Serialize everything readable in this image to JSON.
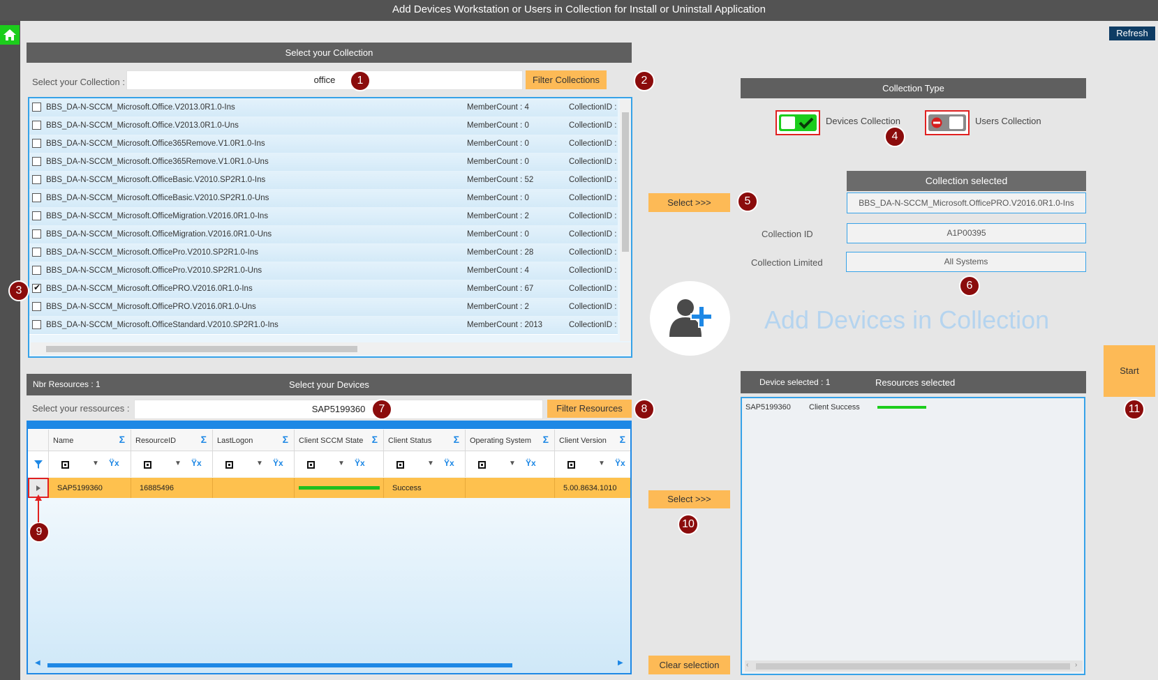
{
  "window": {
    "title": "Add Devices Workstation or Users in Collection for Install or Uninstall Application",
    "refresh_label": "Refresh"
  },
  "collection_panel": {
    "header": "Select your Collection",
    "search_label": "Select your Collection :",
    "search_value": "office",
    "filter_button": "Filter Collections",
    "items": [
      {
        "name": "BBS_DA-N-SCCM_Microsoft.Office.V2013.0R1.0-Ins",
        "member": "MemberCount : 4",
        "cid": "CollectionID :",
        "checked": false
      },
      {
        "name": "BBS_DA-N-SCCM_Microsoft.Office.V2013.0R1.0-Uns",
        "member": "MemberCount : 0",
        "cid": "CollectionID :",
        "checked": false
      },
      {
        "name": "BBS_DA-N-SCCM_Microsoft.Office365Remove.V1.0R1.0-Ins",
        "member": "MemberCount : 0",
        "cid": "CollectionID :",
        "checked": false
      },
      {
        "name": "BBS_DA-N-SCCM_Microsoft.Office365Remove.V1.0R1.0-Uns",
        "member": "MemberCount : 0",
        "cid": "CollectionID :",
        "checked": false
      },
      {
        "name": "BBS_DA-N-SCCM_Microsoft.OfficeBasic.V2010.SP2R1.0-Ins",
        "member": "MemberCount : 52",
        "cid": "CollectionID :",
        "checked": false
      },
      {
        "name": "BBS_DA-N-SCCM_Microsoft.OfficeBasic.V2010.SP2R1.0-Uns",
        "member": "MemberCount : 0",
        "cid": "CollectionID :",
        "checked": false
      },
      {
        "name": "BBS_DA-N-SCCM_Microsoft.OfficeMigration.V2016.0R1.0-Ins",
        "member": "MemberCount : 2",
        "cid": "CollectionID :",
        "checked": false
      },
      {
        "name": "BBS_DA-N-SCCM_Microsoft.OfficeMigration.V2016.0R1.0-Uns",
        "member": "MemberCount : 0",
        "cid": "CollectionID :",
        "checked": false
      },
      {
        "name": "BBS_DA-N-SCCM_Microsoft.OfficePro.V2010.SP2R1.0-Ins",
        "member": "MemberCount : 28",
        "cid": "CollectionID :",
        "checked": false
      },
      {
        "name": "BBS_DA-N-SCCM_Microsoft.OfficePro.V2010.SP2R1.0-Uns",
        "member": "MemberCount : 4",
        "cid": "CollectionID :",
        "checked": false
      },
      {
        "name": "BBS_DA-N-SCCM_Microsoft.OfficePRO.V2016.0R1.0-Ins",
        "member": "MemberCount : 67",
        "cid": "CollectionID :",
        "checked": true
      },
      {
        "name": "BBS_DA-N-SCCM_Microsoft.OfficePRO.V2016.0R1.0-Uns",
        "member": "MemberCount : 2",
        "cid": "CollectionID :",
        "checked": false
      },
      {
        "name": "BBS_DA-N-SCCM_Microsoft.OfficeStandard.V2010.SP2R1.0-Ins",
        "member": "MemberCount : 2013",
        "cid": "CollectionID :",
        "checked": false
      }
    ]
  },
  "collection_type": {
    "header": "Collection Type",
    "devices_label": "Devices Collection",
    "users_label": "Users Collection"
  },
  "select_button_1": "Select  >>>",
  "collection_selected": {
    "header": "Collection selected",
    "name": "BBS_DA-N-SCCM_Microsoft.OfficePRO.V2016.0R1.0-Ins",
    "id_label": "Collection ID",
    "id_value": "A1P00395",
    "limited_label": "Collection Limited",
    "limited_value": "All Systems"
  },
  "big_title": "Add Devices in Collection",
  "devices_panel": {
    "nbr_label": "Nbr Resources : 1",
    "header": "Select your Devices",
    "search_label": "Select your ressources :",
    "search_value": "SAP5199360",
    "filter_button": "Filter Resources",
    "columns": [
      "Name",
      "ResourceID",
      "LastLogon",
      "Client SCCM State",
      "Client Status",
      "Operating System",
      "Client Version"
    ],
    "rows": [
      {
        "name": "SAP5199360",
        "resource_id": "16885496",
        "last_logon": "",
        "client_status": "Success",
        "os": "",
        "version": "5.00.8634.1010"
      }
    ]
  },
  "select_button_2": "Select  >>>",
  "clear_button": "Clear selection",
  "resources_panel": {
    "device_count": "Device selected : 1",
    "header": "Resources selected",
    "items": [
      {
        "name": "SAP5199360",
        "status": "Client Success"
      }
    ]
  },
  "start_button": "Start",
  "badges": [
    "1",
    "2",
    "3",
    "4",
    "5",
    "6",
    "7",
    "8",
    "9",
    "10",
    "11"
  ],
  "colors": {
    "accent_orange": "#fdba56",
    "grid_blue": "#1e88e5",
    "header_gray": "#5f5f5f",
    "badge_red": "#8b0c0c",
    "success_green": "#1ccd1c"
  }
}
